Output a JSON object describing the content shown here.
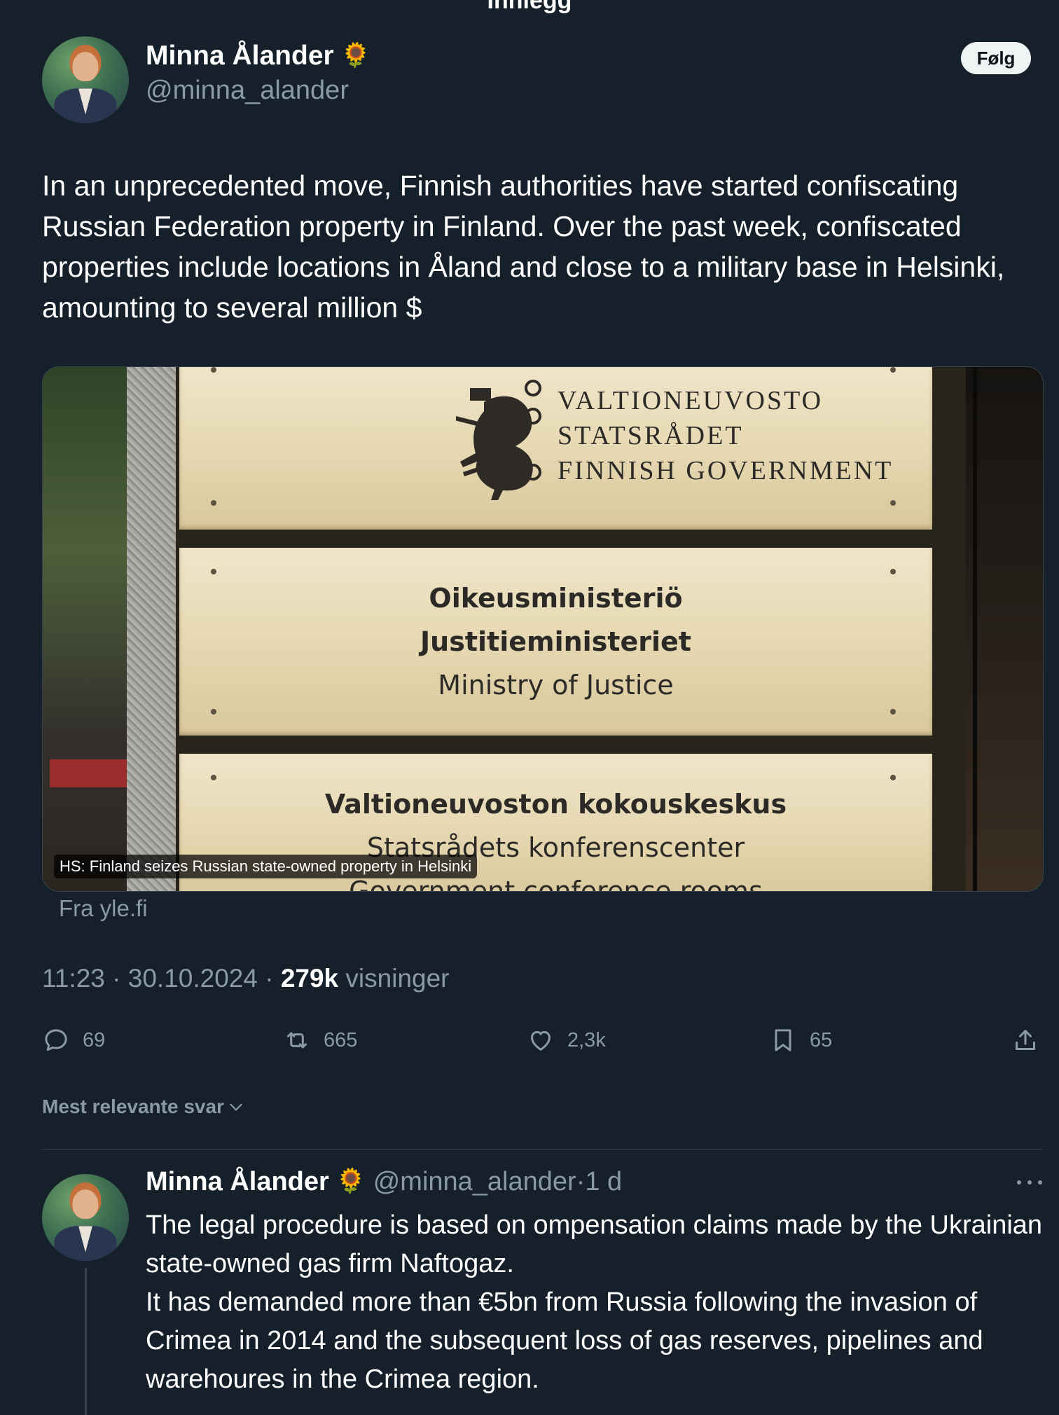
{
  "header": {
    "title": "Innlegg"
  },
  "post": {
    "author": {
      "name": "Minna Ålander",
      "badge_icon": "sunflower-icon",
      "handle": "@minna_alander"
    },
    "follow_label": "Følg",
    "text": "In an unprecedented move, Finnish authorities have started confiscating Russian Federation property in Finland. Over the past week, confiscated properties include locations in Åland and close to a military base in Helsinki, amounting to several million $",
    "card": {
      "caption": "HS: Finland seizes Russian state-owned property in Helsinki",
      "source": "Fra yle.fi",
      "sign": {
        "plate1": [
          "VALTIONEUVOSTO",
          "STATSRÅDET",
          "FINNISH GOVERNMENT"
        ],
        "plate2": [
          "Oikeusministeriö",
          "Justitieministeriet",
          "Ministry of Justice"
        ],
        "plate3": [
          "Valtioneuvoston kokouskeskus",
          "Statsrådets konferenscenter",
          "Government conference rooms"
        ]
      }
    },
    "meta": {
      "time": "11:23",
      "sep1": " · ",
      "date": "30.10.2024",
      "sep2": " · ",
      "views_count": "279k",
      "views_label": " visninger"
    },
    "actions": {
      "replies": "69",
      "reposts": "665",
      "likes": "2,3k",
      "bookmarks": "65"
    }
  },
  "replies_sort": {
    "label": "Mest relevante svar"
  },
  "reply": {
    "author": {
      "name": "Minna Ålander",
      "badge_icon": "sunflower-icon",
      "handle": "@minna_alander",
      "separator": "·",
      "age": "1 d"
    },
    "text_line1": "The legal procedure is based on ompensation claims made by the Ukrainian state-owned gas firm Naftogaz.",
    "text_line2": "It has demanded more than €5bn from Russia following the invasion of Crimea in 2014 and the subsequent loss of gas reserves, pipelines and warehoures in the Crimea region."
  },
  "colors": {
    "background": "#15202b",
    "muted_text": "#8b98a5",
    "divider": "#38444d",
    "follow_button_bg": "#eff3f4"
  }
}
